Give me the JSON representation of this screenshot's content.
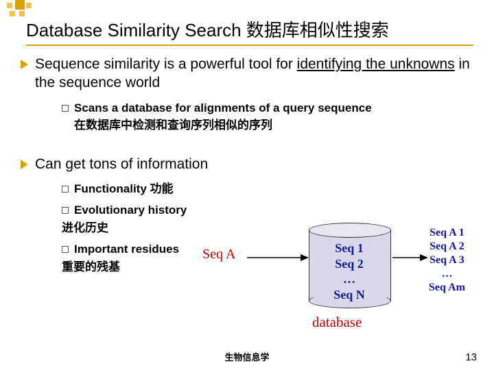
{
  "title": "Database Similarity Search 数据库相似性搜索",
  "bullets": [
    {
      "prefix": "Sequence similarity is a powerful tool for ",
      "underlined": "identifying the unknowns",
      "suffix": " in the sequence world",
      "sub": [
        {
          "line1": "Scans a database for alignments of a query sequence",
          "line2": "在数据库中检测和查询序列相似的序列"
        }
      ]
    },
    {
      "prefix": "Can get tons of information",
      "underlined": "",
      "suffix": "",
      "sub": [
        {
          "line1": "Functionality 功能",
          "line2": ""
        },
        {
          "line1": "Evolutionary history",
          "line2": "进化历史"
        },
        {
          "line1": "Important residues",
          "line2": "重要的残基"
        }
      ]
    }
  ],
  "diagram": {
    "query": "Seq A",
    "db": {
      "items": [
        "Seq 1",
        "Seq 2",
        "…",
        "Seq N"
      ],
      "label": "database"
    },
    "results": [
      "Seq A 1",
      "Seq A 2",
      "Seq A 3",
      "…",
      "Seq Am"
    ]
  },
  "footer": "生物信息学",
  "page": "13"
}
